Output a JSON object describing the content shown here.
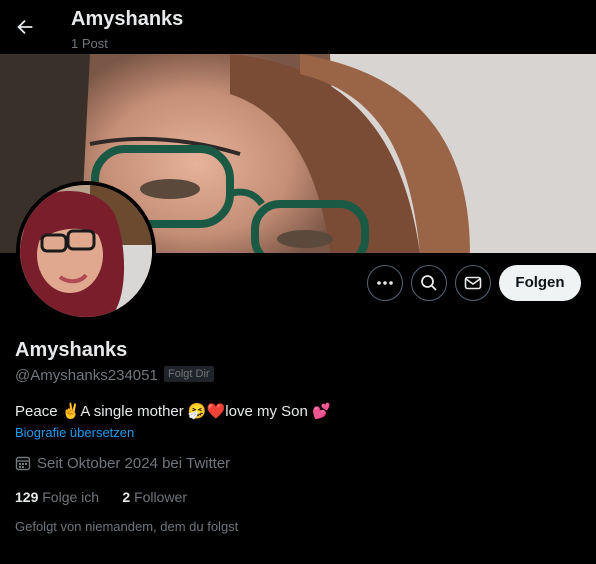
{
  "header": {
    "title": "Amyshanks",
    "subtitle": "1 Post"
  },
  "profile": {
    "display_name": "Amyshanks",
    "handle": "@Amyshanks234051",
    "follows_you_badge": "Folgt Dir",
    "bio": "Peace ✌️A single mother 🤧❤️love my Son 💕",
    "translate_bio": "Biografie übersetzen",
    "joined": "Seit Oktober 2024 bei Twitter",
    "following_count": "129",
    "following_label": "Folge ich",
    "followers_count": "2",
    "followers_label": "Follower",
    "followed_by": "Gefolgt von niemandem, dem du folgst"
  },
  "actions": {
    "more_icon": "more-icon",
    "search_icon": "search-icon",
    "message_icon": "mail-icon",
    "follow_label": "Folgen"
  },
  "colors": {
    "background": "#000000",
    "text": "#e7e9ea",
    "muted": "#71767b",
    "link": "#1d9bf0",
    "button_bg": "#eff3f4"
  }
}
